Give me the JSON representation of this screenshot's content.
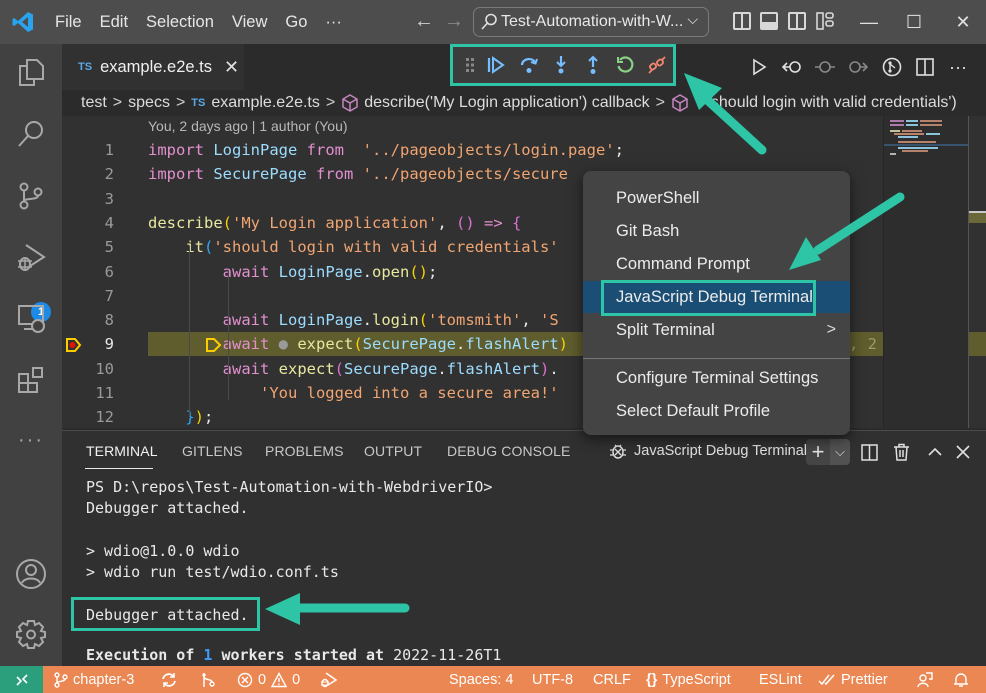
{
  "titlebar": {
    "menu": [
      "File",
      "Edit",
      "Selection",
      "View",
      "Go",
      "···"
    ],
    "back_arrow": "←",
    "forward_arrow": "→",
    "command_center": "Test-Automation-with-W...",
    "window": {
      "minimize": "—",
      "maximize": "☐",
      "close": "✕"
    }
  },
  "activitybar": {
    "items": [
      "explorer",
      "search",
      "source-control",
      "run-and-debug",
      "remote-explorer",
      "extensions",
      "more"
    ],
    "debug_badge": "1",
    "bottom": [
      "accounts",
      "manage"
    ]
  },
  "tab": {
    "lang_badge": "TS",
    "filename": "example.e2e.ts",
    "close": "✕"
  },
  "debug_toolbar": {
    "buttons": [
      "drag-handle",
      "continue",
      "step-over",
      "step-into",
      "step-out",
      "restart",
      "disconnect"
    ]
  },
  "editor_actions": [
    "run",
    "go-back",
    "go-both",
    "go-forward",
    "gitlens",
    "split-editor",
    "more"
  ],
  "breadcrumb": {
    "items": [
      "test",
      "specs",
      "example.e2e.ts",
      "describe('My Login application') callback",
      "should login with valid credentials')"
    ],
    "sep": ">",
    "lang_badge": "TS"
  },
  "editor": {
    "blame": "You, 2 days ago | 1 author (You)",
    "current_line": 9,
    "lines": [
      {
        "n": "1",
        "tokens": [
          [
            "kw",
            "import "
          ],
          [
            "id",
            "LoginPage "
          ],
          [
            "kw",
            "from  "
          ],
          [
            "str",
            "'../pageobjects/login.page'"
          ],
          [
            "plain",
            ";"
          ]
        ]
      },
      {
        "n": "2",
        "tokens": [
          [
            "kw",
            "import "
          ],
          [
            "id",
            "SecurePage "
          ],
          [
            "kw",
            "from "
          ],
          [
            "str",
            "'../pageobjects/secure"
          ]
        ]
      },
      {
        "n": "3",
        "tokens": []
      },
      {
        "n": "4",
        "tokens": [
          [
            "fn",
            "describe"
          ],
          [
            "p1",
            "("
          ],
          [
            "str",
            "'My Login application'"
          ],
          [
            "plain",
            ", "
          ],
          [
            "p2",
            "() "
          ],
          [
            "kw",
            "=> "
          ],
          [
            "p2",
            "{"
          ]
        ]
      },
      {
        "n": "5",
        "tokens": [
          [
            "plain",
            "    "
          ],
          [
            "fn",
            "it"
          ],
          [
            "p3",
            "("
          ],
          [
            "str",
            "'should login with valid credentials'"
          ]
        ]
      },
      {
        "n": "6",
        "tokens": [
          [
            "plain",
            "        "
          ],
          [
            "kw",
            "await "
          ],
          [
            "id",
            "LoginPage"
          ],
          [
            "plain",
            "."
          ],
          [
            "fn",
            "open"
          ],
          [
            "p1",
            "()"
          ],
          [
            "plain",
            ";"
          ]
        ]
      },
      {
        "n": "7",
        "tokens": []
      },
      {
        "n": "8",
        "tokens": [
          [
            "plain",
            "        "
          ],
          [
            "kw",
            "await "
          ],
          [
            "id",
            "LoginPage"
          ],
          [
            "plain",
            "."
          ],
          [
            "fn",
            "login"
          ],
          [
            "p1",
            "("
          ],
          [
            "str",
            "'tomsmith'"
          ],
          [
            "plain",
            ", "
          ],
          [
            "str",
            "'S"
          ]
        ]
      },
      {
        "n": "9",
        "tokens": [
          [
            "plain",
            "        "
          ],
          [
            "kw",
            "await "
          ],
          [
            "plain",
            "● "
          ],
          [
            "fn",
            "expect"
          ],
          [
            "p1",
            "("
          ],
          [
            "id",
            "SecurePage"
          ],
          [
            "plain",
            "."
          ],
          [
            "id",
            "flashAlert"
          ],
          [
            "p1",
            ")"
          ]
        ]
      },
      {
        "n": "10",
        "tokens": [
          [
            "plain",
            "        "
          ],
          [
            "kw",
            "await "
          ],
          [
            "fn",
            "expect"
          ],
          [
            "p2",
            "("
          ],
          [
            "id",
            "SecurePage"
          ],
          [
            "plain",
            "."
          ],
          [
            "id",
            "flashAlert"
          ],
          [
            "p2",
            ")"
          ],
          [
            "plain",
            "."
          ]
        ]
      },
      {
        "n": "11",
        "tokens": [
          [
            "plain",
            "            "
          ],
          [
            "str",
            "'You logged into a secure area!'"
          ]
        ]
      },
      {
        "n": "12",
        "tokens": [
          [
            "plain",
            "    "
          ],
          [
            "p3",
            "}"
          ],
          [
            "p1",
            ")"
          ],
          [
            "plain",
            ";"
          ]
        ]
      }
    ],
    "line9_overflow": ", 2"
  },
  "context_menu": {
    "items": [
      "PowerShell",
      "Git Bash",
      "Command Prompt",
      "JavaScript Debug Terminal",
      "Split Terminal"
    ],
    "selected": "JavaScript Debug Terminal",
    "submenu_chevron": ">",
    "footer_items": [
      "Configure Terminal Settings",
      "Select Default Profile"
    ]
  },
  "panel": {
    "tabs": [
      "TERMINAL",
      "GITLENS",
      "PROBLEMS",
      "OUTPUT",
      "DEBUG CONSOLE"
    ],
    "active_tab": "TERMINAL",
    "terminal_name": "JavaScript Debug Terminal",
    "actions": [
      "new-terminal",
      "launch-profile",
      "split",
      "kill",
      "maximize",
      "close"
    ],
    "lines": [
      "PS D:\\repos\\Test-Automation-with-WebdriverIO>",
      "Debugger attached.",
      "",
      "> wdio@1.0.0 wdio",
      "> wdio run test/wdio.conf.ts",
      "",
      "Debugger attached.",
      ""
    ],
    "exec_line": {
      "prefix": "Execution of ",
      "count": "1",
      "middle": " workers started at ",
      "timestamp": "2022-11-26T1"
    }
  },
  "statusbar": {
    "branch": "chapter-3",
    "errors": "0",
    "warnings": "0",
    "spaces": "Spaces: 4",
    "encoding": "UTF-8",
    "eol": "CRLF",
    "language": "TypeScript",
    "language_icon": "{}",
    "eslint": "ESLint",
    "prettier": "Prettier"
  },
  "colors": {
    "accent_annotation": "#2ec4a6",
    "statusbar": "#ea8753",
    "remote": "#2b9f7c",
    "menu_selected": "#1b4e74",
    "current_line": "#5f5c2d"
  }
}
